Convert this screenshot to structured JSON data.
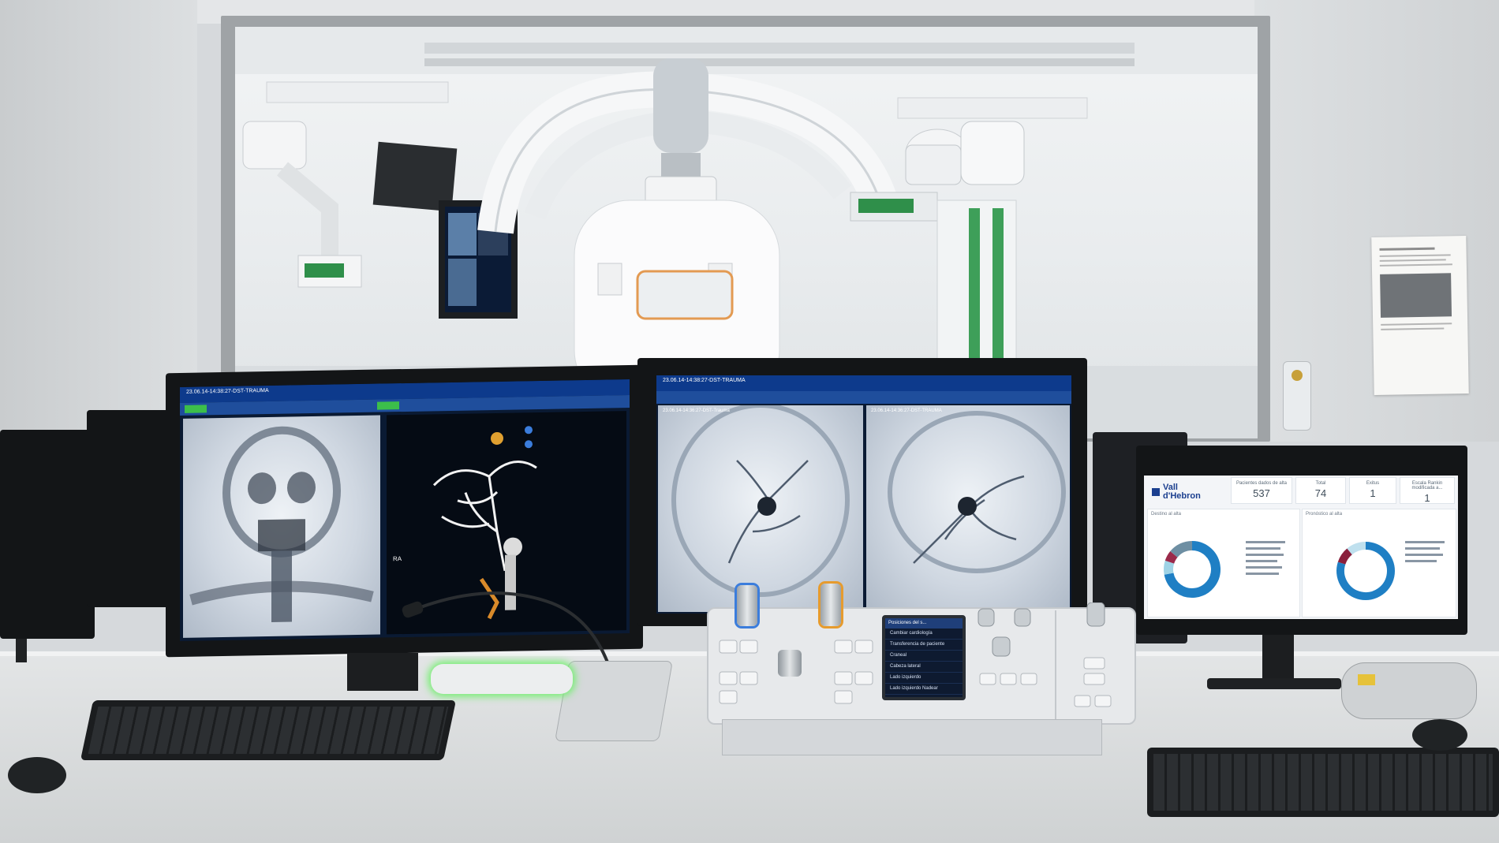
{
  "scene": {
    "description_hidden": "",
    "left_monitor": {
      "title_bar": "23.06.14-14:38:27-DST-TRAUMA",
      "side_label": "RA"
    },
    "center_monitor": {
      "title_bar": "23.06.14-14:38:27-DST-TRAUMA",
      "frame_label_left": "23.06.14-14:36:27-DST-Trauma",
      "frame_label_right": "23.06.14-14:36:27-DST-TRAUMA"
    },
    "control_panel": {
      "menu_title": "Posiciones del s...",
      "menu_items": [
        "Cambiar cardiología",
        "Transferencia de paciente",
        "Craneal",
        "Cabeza lateral",
        "Lado izquierdo",
        "Lado izquierdo Nadear"
      ]
    },
    "dashboard": {
      "logo_line1": "Vall",
      "logo_line2": "d'Hebron",
      "kpis": [
        {
          "label": "Pacientes dados de alta",
          "value": "537"
        },
        {
          "label": "Total",
          "value": "74"
        },
        {
          "label": "Exitus",
          "value": "1"
        },
        {
          "label": "Escala Rankin modificada a...",
          "value": "1"
        }
      ],
      "panel_left_title": "Destino al alta",
      "panel_right_title": "Pronóstico al alta",
      "donut_left": {
        "segments": [
          0.72,
          0.08,
          0.06,
          0.14
        ],
        "colors": [
          "#1f7fc4",
          "#9fd3e6",
          "#9a2a4a",
          "#6e8fa3"
        ]
      },
      "donut_right": {
        "segments": [
          0.8,
          0.09,
          0.11
        ],
        "colors": [
          "#1f7fc4",
          "#8a1f3c",
          "#bfe0ee"
        ]
      }
    },
    "colors": {
      "ui_blue": "#0d3a8c",
      "xray_bg": "#cfd7e1",
      "dashboard_bg": "#f3f5f8",
      "knob_blue": "#3b7ddc",
      "knob_orange": "#e69b2e"
    }
  }
}
